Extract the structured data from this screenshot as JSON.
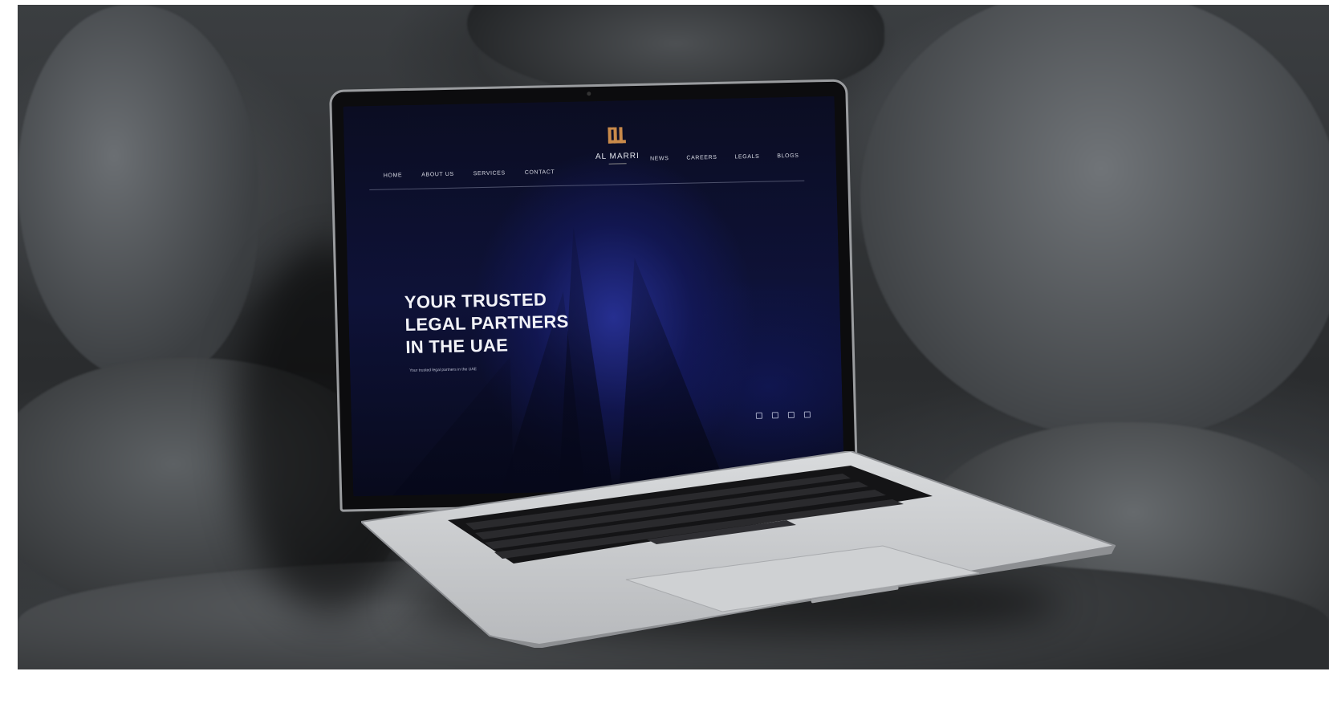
{
  "site": {
    "logo_text": "AL MARRI",
    "nav_left": [
      "HOME",
      "ABOUT US",
      "SERVICES",
      "CONTACT"
    ],
    "nav_right": [
      "NEWS",
      "CAREERS",
      "LEGALS",
      "BLOGS"
    ],
    "hero": {
      "lines": [
        "YOUR TRUSTED",
        "LEGAL PARTNERS",
        "IN THE UAE"
      ],
      "subtitle": "Your trusted legal partners in the UAE"
    },
    "social_icons": [
      "linkedin-icon",
      "facebook-icon",
      "twitter-icon",
      "instagram-icon"
    ]
  },
  "colors": {
    "screen_blue": "#1c2470",
    "logo_gold": "#c98a4a",
    "rock_gray": "#4a4d50",
    "laptop_silver": "#c9cbcd"
  }
}
